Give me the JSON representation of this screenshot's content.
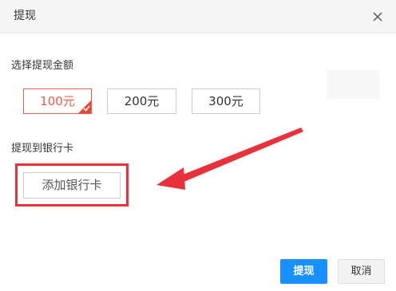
{
  "dialog": {
    "title": "提现",
    "close_icon": "close-icon"
  },
  "amount_section": {
    "label": "选择提现金额",
    "options": [
      {
        "label": "100元",
        "selected": true
      },
      {
        "label": "200元",
        "selected": false
      },
      {
        "label": "300元",
        "selected": false
      }
    ],
    "selected_icon": "checkmark-icon"
  },
  "bank_section": {
    "label": "提现到银行卡",
    "add_card_label": "添加银行卡"
  },
  "annotation": {
    "highlight_color": "#e8313a",
    "arrow_color": "#e8313a"
  },
  "footer": {
    "confirm_label": "提现",
    "cancel_label": "取消"
  },
  "colors": {
    "primary": "#1890ff",
    "selected_accent": "#f0594b"
  }
}
